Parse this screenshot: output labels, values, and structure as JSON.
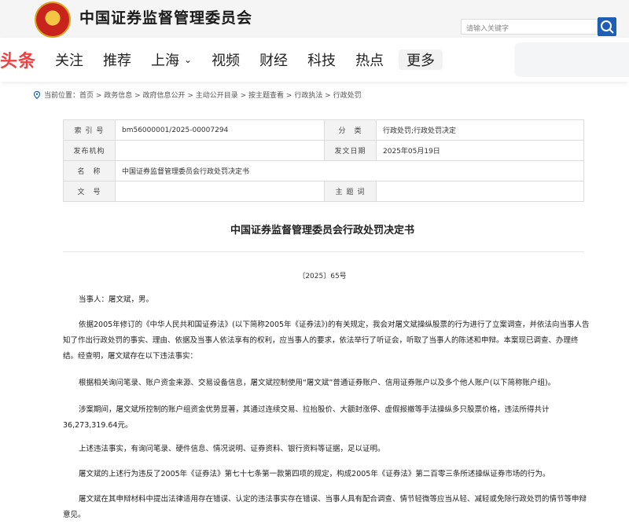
{
  "csrc": {
    "site_title": "中国证券监督管理委员会",
    "search_placeholder": "请输入关键字"
  },
  "nav": {
    "logo": "头条",
    "items": [
      "关注",
      "推荐",
      "上海",
      "视频",
      "财经",
      "科技",
      "热点",
      "更多"
    ]
  },
  "breadcrumb": "当前位置：首页 > 政务信息 > 政府信息公开 > 主动公开目录 > 按主题查看 > 行政执法 > 行政处罚",
  "meta": {
    "index_label": "索 引 号",
    "index_value": "bm56000001/2025-00007294",
    "category_label": "分　类",
    "category_value": "行政处罚;行政处罚决定",
    "issuer_label": "发布机构",
    "issuer_value": "",
    "date_label": "发文日期",
    "date_value": "2025年05月19日",
    "name_label": "名　称",
    "name_value": "中国证券监督管理委员会行政处罚决定书",
    "docno_label": "文　号",
    "docno_value": "",
    "topic_label": "主 题 词",
    "topic_value": ""
  },
  "document": {
    "title": "中国证券监督管理委员会行政处罚决定书",
    "number": "〔2025〕65号",
    "paragraphs": [
      "当事人：屠文斌，男。",
      "依据2005年修订的《中华人民共和国证券法》(以下简称2005年《证券法》)的有关规定，我会对屠文斌操纵股票的行为进行了立案调查，并依法向当事人告知了作出行政处罚的事实、理由、依据及当事人依法享有的权利，应当事人的要求，依法举行了听证会，听取了当事人的陈述和申辩。本案现已调查、办理终结。经查明，屠文斌存在以下违法事实：",
      "根据相关询问笔录、账户资金来源、交易设备信息，屠文斌控制使用“屠文斌”普通证券账户、信用证券账户以及多个他人账户(以下简称账户组)。",
      "涉案期间，屠文斌所控制的账户组资金优势显著，其通过连续交易、拉抬股价、大额封涨停、虚假报撤等手法操纵多只股票价格，违法所得共计36,273,319.64元。",
      "上述违法事实，有询问笔录、硬件信息、情况说明、证券资料、银行资料等证据，足以证明。",
      "屠文斌的上述行为违反了2005年《证券法》第七十七条第一款第四项的规定，构成2005年《证券法》第二百零三条所述操纵证券市场的行为。",
      "屠文斌在其申辩材料中提出法律适用存在错误、认定的违法事实存在错误、当事人具有配合调查、情节轻微等应当从轻、减轻或免除行政处罚的情节等申辩意见。"
    ]
  }
}
